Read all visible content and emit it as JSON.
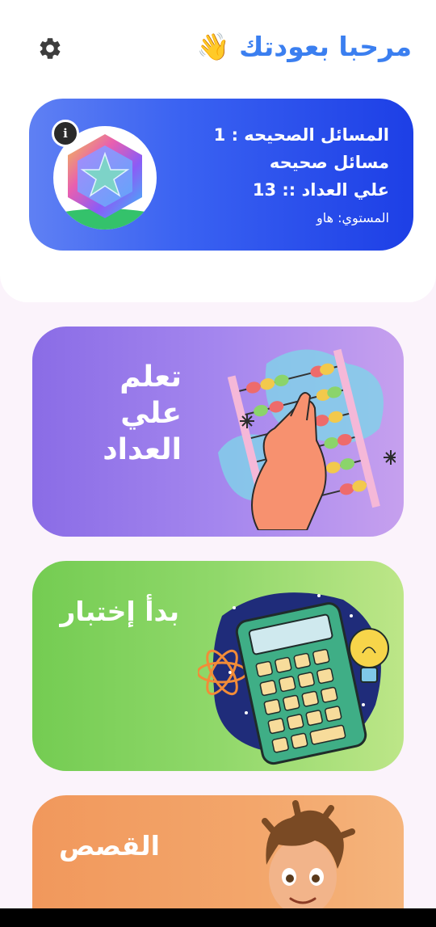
{
  "header": {
    "greeting": "مرحبا بعودتك 👋",
    "settings_icon": "gear-icon"
  },
  "stats": {
    "correct_problems": "المسائل الصحيحه : 1",
    "abacus_correct_line1": "مسائل صحيحه",
    "abacus_correct_line2": "علي العداد :: 13",
    "level": "المستوي: هاو",
    "info_glyph": "i",
    "badge_icon": "star-hexagon-badge-icon"
  },
  "cards": {
    "abacus": {
      "title_line1": "تعلم",
      "title_line2": "علي",
      "title_line3": "العداد",
      "art": "abacus-hand-illustration"
    },
    "quiz": {
      "title": "بدأ إختبار",
      "art": "calculator-illustration"
    },
    "stories": {
      "title": "القصص",
      "art": "boy-character-illustration"
    }
  },
  "colors": {
    "accent": "#3b7ff0",
    "stats_card": "#2d52ee",
    "abacus_card": "#a486ee",
    "quiz_card": "#90d86a",
    "stories_card": "#f3a66b"
  }
}
